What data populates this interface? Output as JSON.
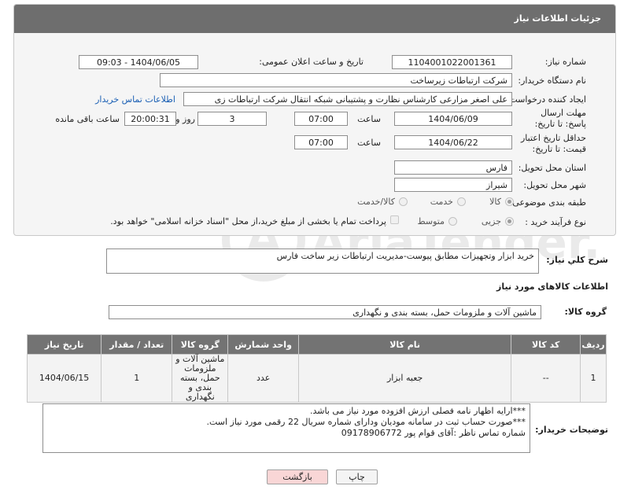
{
  "panel": {
    "title": "جزئیات اطلاعات نیاز"
  },
  "labels": {
    "need_number": "شماره نیاز:",
    "announce_datetime": "تاریخ و ساعت اعلان عمومی:",
    "buyer_org": "نام دستگاه خریدار:",
    "requester": "ایجاد کننده درخواست:",
    "contact_link": "اطلاعات تماس خریدار",
    "send_deadline": "مهلت ارسال پاسخ: تا تاریخ:",
    "hour": "ساعت",
    "days_and": "روز و",
    "time_remaining": "ساعت باقی مانده",
    "price_validity": "حداقل تاریخ اعتبار قیمت: تا تاریخ:",
    "hour2": "ساعت",
    "delivery_province": "استان محل تحویل:",
    "delivery_city": "شهر محل تحویل:",
    "category": "طبقه بندی موضوعی:",
    "purchase_type": "نوع فرآیند خرید :",
    "description": "شرح كلي نياز:",
    "goods_info": "اطلاعات کالاهای مورد نیاز",
    "goods_group": "گروه کالا:",
    "buyer_notes": "توضیحات خریدار:"
  },
  "values": {
    "need_number": "1104001022001361",
    "announce_datetime": "1404/06/05 - 09:03",
    "buyer_org": "شرکت ارتباطات زیرساخت",
    "requester": "علی اصغر مزارعی کارشناس نظارت و پشتیبانی شبکه انتقال شرکت ارتباطات زی",
    "deadline_date": "1404/06/09",
    "deadline_time": "07:00",
    "days_remaining": "3",
    "hours_remaining": "20:00:31",
    "validity_date": "1404/06/22",
    "validity_time": "07:00",
    "province": "فارس",
    "city": "شیراز",
    "description": "خرید ابزار وتجهیزات مطابق پیوست-مدیریت ارتباطات زیر ساخت فارس",
    "goods_group": "ماشین آلات و ملزومات حمل، بسته بندی و نگهداری",
    "notes_line1": "***ارایه اظهار نامه فصلی ارزش افزوده مورد نیاز می باشد.",
    "notes_line2": "***صورت حساب ثبت در سامانه مودیان ودارای شماره سریال 22 رقمی مورد نیاز است.",
    "notes_line3": "شماره تماس ناظر :آقای قوام پور 09178906772"
  },
  "category_options": [
    {
      "label": "کالا",
      "selected": true
    },
    {
      "label": "خدمت",
      "selected": false
    },
    {
      "label": "کالا/خدمت",
      "selected": false
    }
  ],
  "purchase_options": [
    {
      "label": "جزیی",
      "selected": true
    },
    {
      "label": "متوسط",
      "selected": false
    }
  ],
  "payment_note": "پرداخت تمام یا بخشی از مبلغ خرید،از محل \"اسناد خزانه اسلامی\" خواهد بود.",
  "table": {
    "headers": [
      "ردیف",
      "کد کالا",
      "نام کالا",
      "واحد شمارش",
      "گروه کالا",
      "تعداد / مقدار",
      "تاریخ نیاز"
    ],
    "rows": [
      [
        "1",
        "--",
        "جعبه ابزار",
        "عدد",
        "ماشین آلات و ملزومات حمل، بسته بندی و نگهداری",
        "1",
        "1404/06/15"
      ]
    ]
  },
  "buttons": {
    "print": "چاپ",
    "back": "بازگشت"
  },
  "watermark": "AriaTender.net",
  "colors": {
    "header_bg": "#6e6e6e",
    "link": "#1a5fb4",
    "back_button_bg": "#f9d6d6"
  }
}
